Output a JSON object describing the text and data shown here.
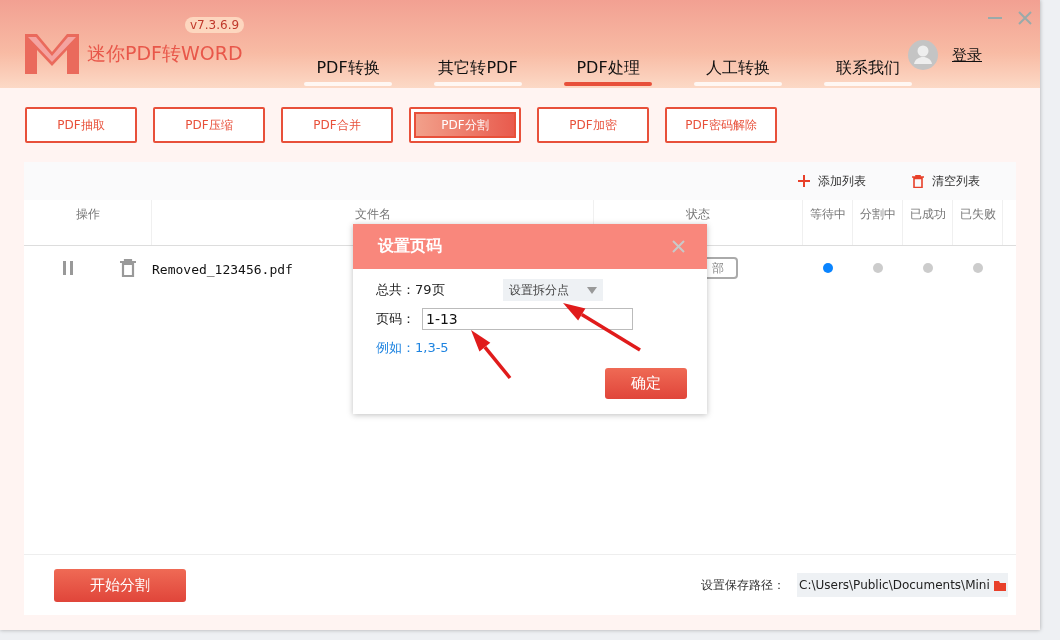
{
  "app": {
    "version": "v7.3.6.9",
    "title": "迷你PDF转WORD",
    "login": "登录"
  },
  "nav_tabs": [
    {
      "label": "PDF转换",
      "selected": false
    },
    {
      "label": "其它转PDF",
      "selected": false
    },
    {
      "label": "PDF处理",
      "selected": true
    },
    {
      "label": "人工转换",
      "selected": false
    },
    {
      "label": "联系我们",
      "selected": false
    }
  ],
  "tools": [
    {
      "label": "PDF抽取",
      "selected": false
    },
    {
      "label": "PDF压缩",
      "selected": false
    },
    {
      "label": "PDF合并",
      "selected": false
    },
    {
      "label": "PDF分割",
      "selected": true
    },
    {
      "label": "PDF加密",
      "selected": false
    },
    {
      "label": "PDF密码解除",
      "selected": false
    }
  ],
  "toolbar": [
    {
      "kind": "add",
      "label": "添加列表"
    },
    {
      "kind": "clear",
      "label": "清空列表"
    }
  ],
  "table": {
    "columns": [
      {
        "label": "操作"
      },
      {
        "label": "文件名"
      },
      {
        "label": "状态"
      },
      {
        "label": "等待中"
      },
      {
        "label": "分割中"
      },
      {
        "label": "已成功"
      },
      {
        "label": "已失败"
      }
    ],
    "rows": [
      {
        "file": "Removed_123456.pdf",
        "status": "部",
        "stages": [
          {
            "active": true
          },
          {
            "active": false
          },
          {
            "active": false
          },
          {
            "active": false
          }
        ]
      }
    ]
  },
  "footer": {
    "start_button": "开始分割",
    "save_path_label": "设置保存路径：",
    "save_path": "C:\\Users\\Public\\Documents\\Mini"
  },
  "dialog": {
    "title": "设置页码",
    "total": "总共：79页",
    "dropdown": "设置拆分点",
    "page_label": "页码：",
    "page_value": "1-13",
    "example": "例如：1,3-5",
    "confirm": "确定"
  }
}
